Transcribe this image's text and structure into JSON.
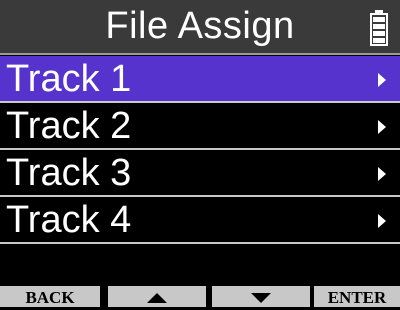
{
  "header": {
    "title": "File Assign",
    "battery_icon": "battery-icon"
  },
  "list": {
    "items": [
      {
        "label": "Track 1",
        "selected": true
      },
      {
        "label": "Track 2",
        "selected": false
      },
      {
        "label": "Track 3",
        "selected": false
      },
      {
        "label": "Track 4",
        "selected": false
      }
    ]
  },
  "footer": {
    "back_label": "BACK",
    "up_icon": "up-arrow-icon",
    "down_icon": "down-arrow-icon",
    "enter_label": "ENTER"
  },
  "colors": {
    "selection": "#5533cc",
    "header_bg": "#3a3a3a",
    "button_bg": "#c8c8c8"
  }
}
